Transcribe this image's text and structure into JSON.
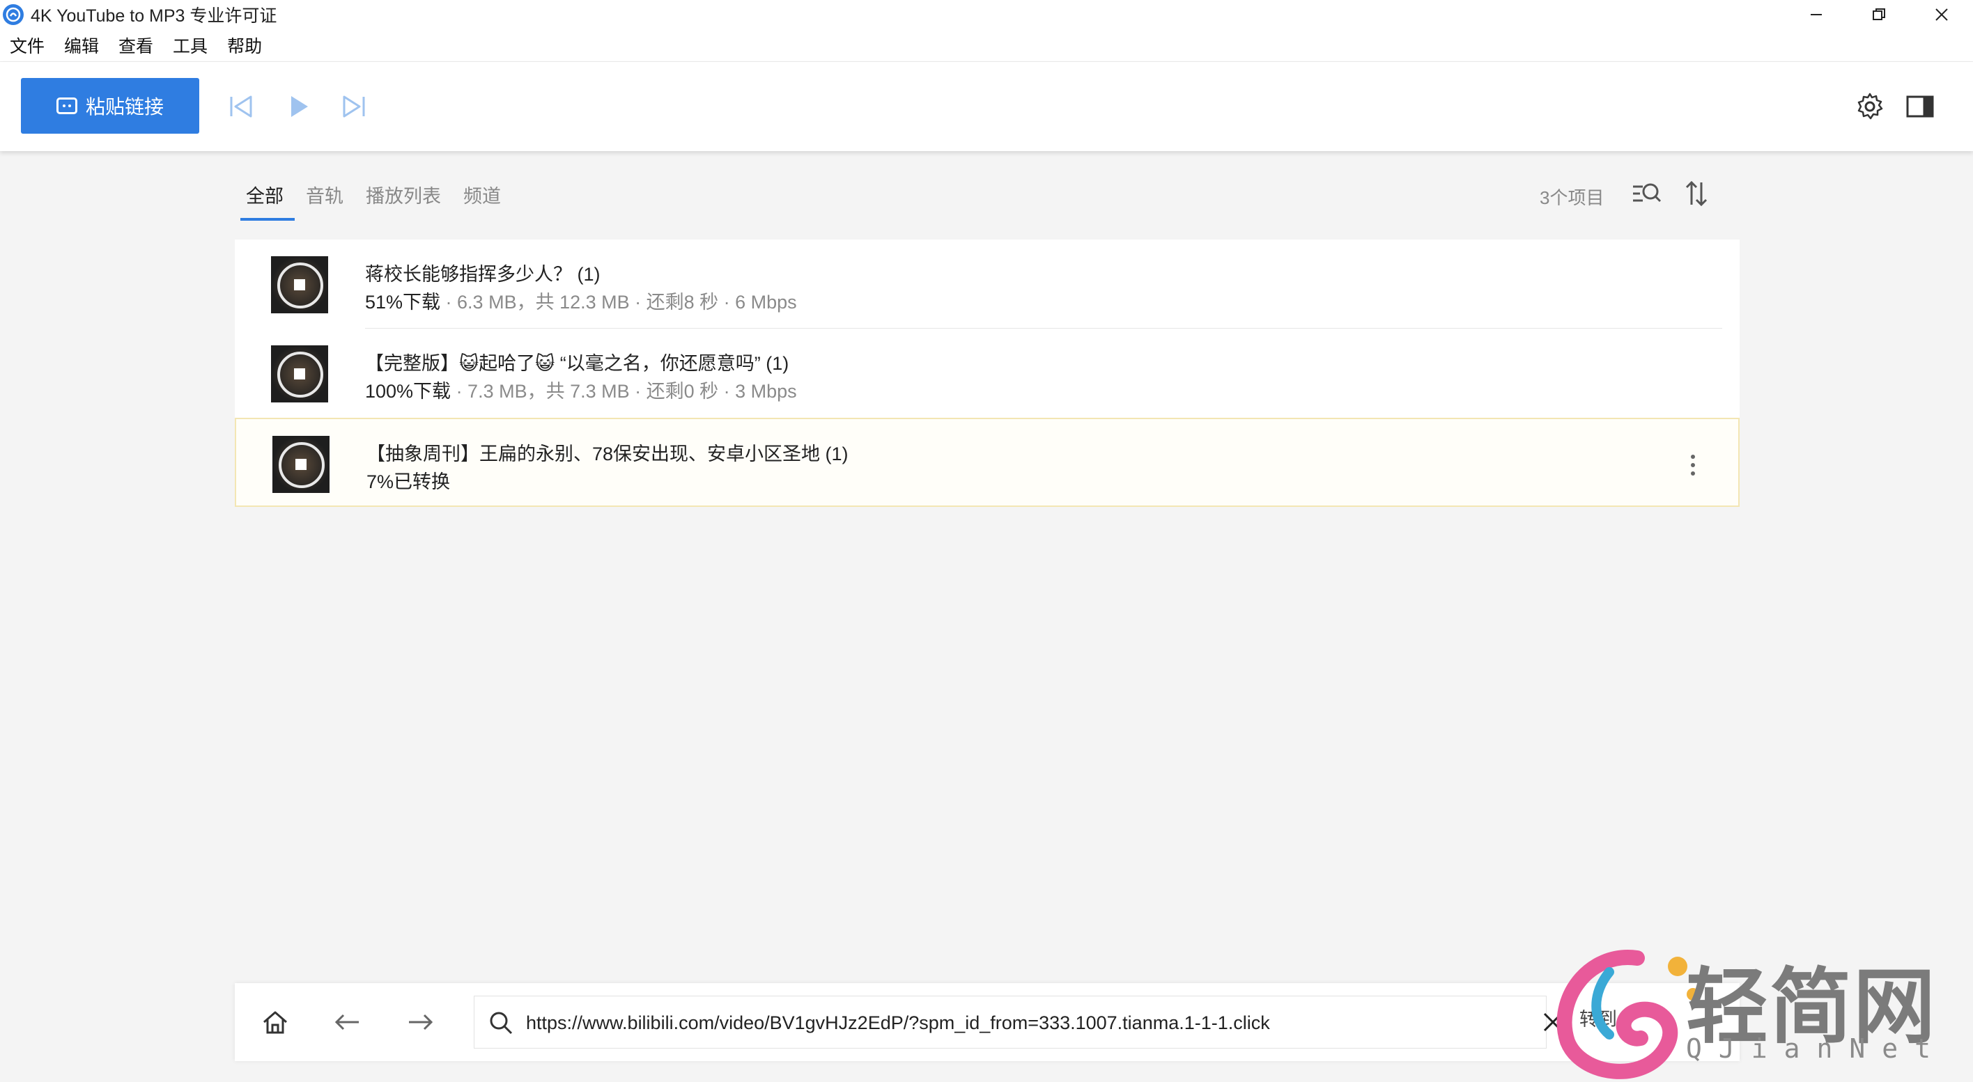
{
  "window": {
    "title": "4K YouTube to MP3 专业许可证",
    "app_icon": "4k-logo-icon",
    "controls": [
      "minimize-icon",
      "restore-icon",
      "close-icon"
    ]
  },
  "menu": {
    "items": [
      "文件",
      "编辑",
      "查看",
      "工具",
      "帮助"
    ]
  },
  "toolbar": {
    "paste_label": "粘贴链接",
    "accent_color": "#2f7de1",
    "icons": [
      "previous-icon",
      "play-icon",
      "next-icon",
      "settings-icon",
      "sidebar-panel-icon"
    ]
  },
  "tabs": {
    "items": [
      "全部",
      "音轨",
      "播放列表",
      "频道"
    ],
    "active": "全部"
  },
  "list_header": {
    "count": "3个项目"
  },
  "items": [
    {
      "title": "蒋校长能够指挥多少人？ (1)",
      "status_pct": "51%下载",
      "status_details": " · 6.3 MB，共 12.3 MB · 还剩8 秒 · 6 Mbps"
    },
    {
      "title": "【完整版】😺起哈了😺 “以毫之名，你还愿意吗” (1)",
      "status_pct": "100%下载",
      "status_details": " · 7.3 MB，共 7.3 MB · 还剩0 秒 · 3 Mbps"
    },
    {
      "title": "【抽象周刊】王扁的永别、78保安出现、安卓小区圣地 (1)",
      "status_pct": "7%已转换",
      "status_details": ""
    }
  ],
  "browser": {
    "url": "https://www.bilibili.com/video/BV1gvHJz2EdP/?spm_id_from=333.1007.tianma.1-1-1.click",
    "goto_label": "转到"
  },
  "watermark": {
    "text": "轻简网",
    "sub": "QJianNet"
  }
}
